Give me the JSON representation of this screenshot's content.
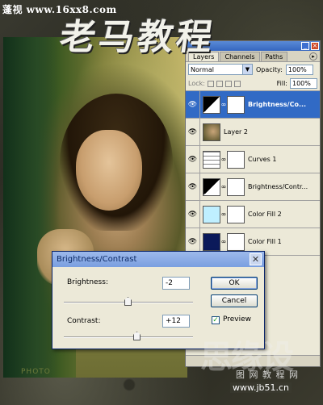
{
  "watermark_top": "蓬视 www.16xx8.com",
  "title_calligraphy": "老马教程",
  "photo_watermark": "PHOTO",
  "layers_panel": {
    "tabs": [
      "Layers",
      "Channels",
      "Paths"
    ],
    "blend_mode": "Normal",
    "opacity_label": "Opacity:",
    "opacity_value": "100%",
    "lock_label": "Lock:",
    "fill_label": "Fill:",
    "fill_value": "100%",
    "layers": [
      {
        "name": "Brightness/Co...",
        "selected": true
      },
      {
        "name": "Layer 2",
        "selected": false
      },
      {
        "name": "Curves 1",
        "selected": false
      },
      {
        "name": "Brightness/Contr...",
        "selected": false
      },
      {
        "name": "Color Fill 2",
        "selected": false
      },
      {
        "name": "Color Fill 1",
        "selected": false
      }
    ]
  },
  "dialog": {
    "title": "Brightness/Contrast",
    "brightness_label": "Brightness:",
    "brightness_value": "-2",
    "contrast_label": "Contrast:",
    "contrast_value": "+12",
    "ok_label": "OK",
    "cancel_label": "Cancel",
    "preview_label": "Preview",
    "preview_checked": true
  },
  "watermark_br": {
    "big": "思缘设",
    "mid": "图 网 教 程 网",
    "url": "www.jb51.cn"
  },
  "colors": {
    "selected_layer": "#316ac5",
    "dialog_title": "#7a9fe0"
  }
}
